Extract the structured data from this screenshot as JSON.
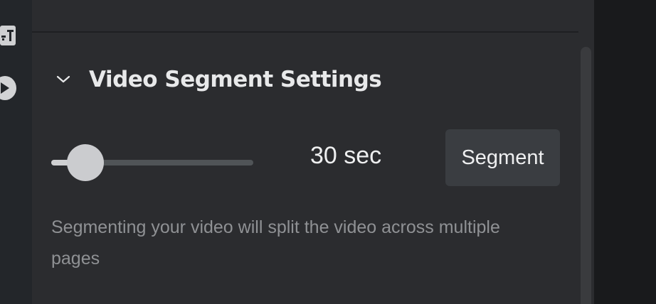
{
  "rail": {
    "icons": [
      "add-text-icon",
      "play-icon"
    ]
  },
  "section": {
    "title": "Video Segment Settings",
    "expanded": true,
    "chevron_icon": "chevron-down-icon"
  },
  "segment": {
    "slider_fraction": 0.17,
    "duration_label": "30 sec",
    "button_label": "Segment",
    "help_text": "Segmenting your video will split the video across multiple pages"
  },
  "colors": {
    "panel_bg": "#2b2c2f",
    "button_bg": "#3a3d41",
    "text_primary": "#eeeff0",
    "text_muted": "#8f9194"
  }
}
